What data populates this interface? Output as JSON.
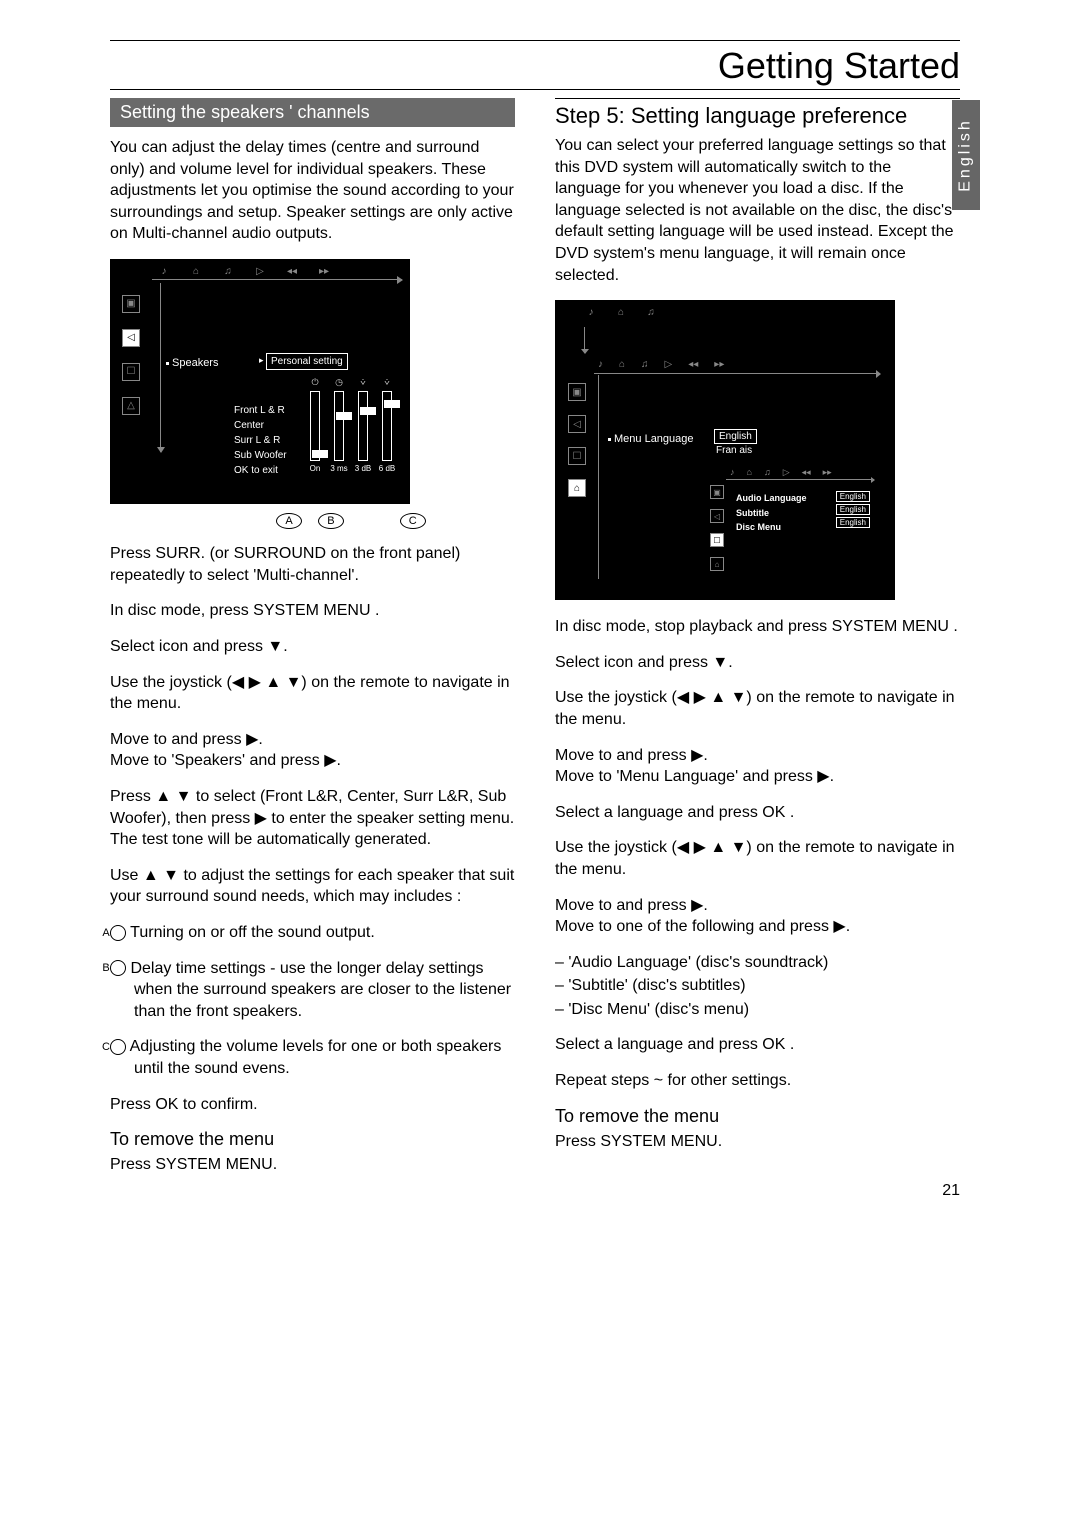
{
  "header": {
    "title": "Getting Started"
  },
  "side_tab": "English",
  "page_number": "21",
  "left": {
    "section_title": "Setting the speakers ' channels",
    "intro": "You can adjust the delay times (centre and surround only) and volume level for individual speakers.  These adjustments let you optimise the sound according to your surroundings and setup.  Speaker settings are only active on Multi-channel audio outputs.",
    "diagram": {
      "speakers_label": "Speakers",
      "personal_setting": "Personal setting",
      "rows": [
        "Front L & R",
        "Center",
        "Surr L & R",
        "Sub Woofer",
        "OK to exit"
      ],
      "caps": [
        "On",
        "3 ms",
        "3 dB",
        "6 dB"
      ],
      "abc": [
        "A",
        "B",
        "C"
      ]
    },
    "s1": "Press SURR. (or SURROUND  on the front panel) repeatedly to select 'Multi-channel'.",
    "s2": "In disc mode, press SYSTEM MENU .",
    "s3": "Select       icon and press ▼.",
    "s4": "Use the joystick (◀ ▶ ▲ ▼) on the remote to navigate in the menu.",
    "s5a": "Move to        and press ▶.",
    "s5b": "Move to 'Speakers' and press ▶.",
    "s6": "Press ▲ ▼ to select (Front L&R, Center, Surr L&R, Sub Woofer), then press ▶ to enter the speaker setting menu.",
    "s6b": "     The test tone will be automatically generated.",
    "s7": "Use ▲ ▼ to adjust the settings for each speaker that suit your surround sound needs, which may includes :",
    "optA": "Turning on or off the sound output.",
    "optB": "Delay time settings - use the longer delay settings when the surround speakers are closer to the listener than the front speakers.",
    "optC": "Adjusting the volume levels for one or both speakers until the sound evens.",
    "s8": "Press OK  to confirm.",
    "remove_head": "To remove the menu",
    "remove_body": "Press SYSTEM MENU."
  },
  "right": {
    "step_head": "Step 5:  Setting language preference",
    "intro": "You can select your preferred language settings so that this DVD system will automatically switch to the language for you whenever you load a disc.  If the language selected is not available on the disc, the disc's default setting language will be used instead.  Except the DVD system's menu language, it will remain once selected.",
    "diagram": {
      "menu_language": "Menu Language",
      "english": "English",
      "franais": "Fran ais",
      "sub_items": [
        "Audio Language",
        "Subtitle",
        "Disc Menu"
      ],
      "sub_vals": [
        "English",
        "English",
        "English"
      ]
    },
    "s1": "In disc mode, stop playback and press SYSTEM MENU .",
    "s2": "Select       icon and press ▼.",
    "s3": "Use the joystick (◀ ▶ ▲ ▼) on the remote to navigate in the menu.",
    "s4a": "Move to        and press ▶.",
    "s4b": "Move to 'Menu Language' and press ▶.",
    "s5": "Select a language and press OK .",
    "s6": "Use the joystick (◀ ▶ ▲ ▼) on the remote to navigate in the menu.",
    "s7a": "Move to        and press ▶.",
    "s7b": "Move to one of the following and press ▶.",
    "li1": "–   'Audio Language' (disc's soundtrack)",
    "li2": "–   'Subtitle' (disc's subtitles)",
    "li3": "–   'Disc Menu' (disc's menu)",
    "s8": "Select a language and press OK .",
    "s9": "Repeat steps       ~       for other settings.",
    "remove_head": "To remove the menu",
    "remove_body": "Press SYSTEM MENU."
  }
}
